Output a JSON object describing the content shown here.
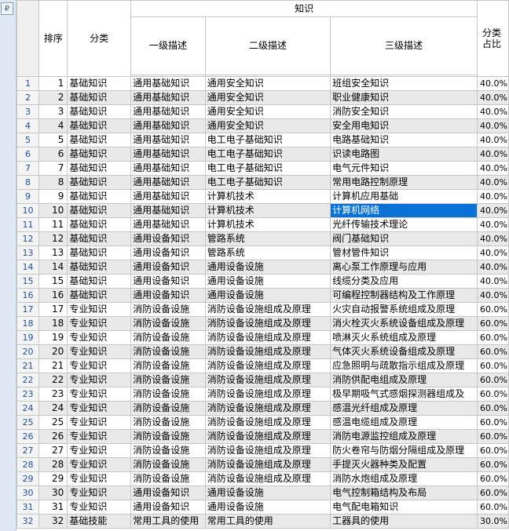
{
  "header": {
    "group": "知识",
    "col_order": "排序",
    "col_category": "分类",
    "col_level1": "一级描述",
    "col_level2": "二级描述",
    "col_level3": "三级描述",
    "col_ratio_line1": "分类",
    "col_ratio_line2": "占比"
  },
  "rows": [
    {
      "n": "1",
      "order": "1",
      "cat": "基础知识",
      "l1": "通用基础知识",
      "l2": "通用安全知识",
      "l3": "班组安全知识",
      "ratio": "40.0%"
    },
    {
      "n": "2",
      "order": "2",
      "cat": "基础知识",
      "l1": "通用基础知识",
      "l2": "通用安全知识",
      "l3": "职业健康知识",
      "ratio": "40.0%"
    },
    {
      "n": "3",
      "order": "3",
      "cat": "基础知识",
      "l1": "通用基础知识",
      "l2": "通用安全知识",
      "l3": "消防安全知识",
      "ratio": "40.0%"
    },
    {
      "n": "4",
      "order": "4",
      "cat": "基础知识",
      "l1": "通用基础知识",
      "l2": "通用安全知识",
      "l3": "安全用电知识",
      "ratio": "40.0%"
    },
    {
      "n": "5",
      "order": "5",
      "cat": "基础知识",
      "l1": "通用基础知识",
      "l2": "电工电子基础知识",
      "l3": "电路基础知识",
      "ratio": "40.0%"
    },
    {
      "n": "6",
      "order": "6",
      "cat": "基础知识",
      "l1": "通用基础知识",
      "l2": "电工电子基础知识",
      "l3": "识读电路图",
      "ratio": "40.0%"
    },
    {
      "n": "7",
      "order": "7",
      "cat": "基础知识",
      "l1": "通用基础知识",
      "l2": "电工电子基础知识",
      "l3": "电气元件知识",
      "ratio": "40.0%"
    },
    {
      "n": "8",
      "order": "8",
      "cat": "基础知识",
      "l1": "通用基础知识",
      "l2": "电工电子基础知识",
      "l3": "常用电路控制原理",
      "ratio": "40.0%"
    },
    {
      "n": "9",
      "order": "9",
      "cat": "基础知识",
      "l1": "通用基础知识",
      "l2": "计算机技术",
      "l3": "计算机应用基础",
      "ratio": "40.0%"
    },
    {
      "n": "10",
      "order": "10",
      "cat": "基础知识",
      "l1": "通用基础知识",
      "l2": "计算机技术",
      "l3": "计算机网络",
      "ratio": "40.0%"
    },
    {
      "n": "11",
      "order": "11",
      "cat": "基础知识",
      "l1": "通用基础知识",
      "l2": "计算机技术",
      "l3": "光纤传输技术理论",
      "ratio": "40.0%"
    },
    {
      "n": "12",
      "order": "12",
      "cat": "基础知识",
      "l1": "通用设备知识",
      "l2": "管路系统",
      "l3": "阀门基础知识",
      "ratio": "40.0%"
    },
    {
      "n": "13",
      "order": "13",
      "cat": "基础知识",
      "l1": "通用设备知识",
      "l2": "管路系统",
      "l3": "管材管件知识",
      "ratio": "40.0%"
    },
    {
      "n": "14",
      "order": "14",
      "cat": "基础知识",
      "l1": "通用设备知识",
      "l2": "通用设备设施",
      "l3": "离心泵工作原理与应用",
      "ratio": "40.0%"
    },
    {
      "n": "15",
      "order": "15",
      "cat": "基础知识",
      "l1": "通用设备知识",
      "l2": "通用设备设施",
      "l3": "线缆分类及应用",
      "ratio": "40.0%"
    },
    {
      "n": "16",
      "order": "16",
      "cat": "基础知识",
      "l1": "通用设备知识",
      "l2": "通用设备设施",
      "l3": "可编程控制器结构及工作原理",
      "ratio": "40.0%"
    },
    {
      "n": "17",
      "order": "17",
      "cat": "专业知识",
      "l1": "消防设备设施",
      "l2": "消防设备设施组成及原理",
      "l3": "火灾自动报警系统组成及原理",
      "ratio": "60.0%"
    },
    {
      "n": "18",
      "order": "18",
      "cat": "专业知识",
      "l1": "消防设备设施",
      "l2": "消防设备设施组成及原理",
      "l3": "消火栓灭火系统设备组成及原理",
      "ratio": "60.0%"
    },
    {
      "n": "19",
      "order": "19",
      "cat": "专业知识",
      "l1": "消防设备设施",
      "l2": "消防设备设施组成及原理",
      "l3": "喷淋灭火系统组成及原理",
      "ratio": "60.0%"
    },
    {
      "n": "20",
      "order": "20",
      "cat": "专业知识",
      "l1": "消防设备设施",
      "l2": "消防设备设施组成及原理",
      "l3": "气体灭火系统设备组成及原理",
      "ratio": "60.0%"
    },
    {
      "n": "21",
      "order": "21",
      "cat": "专业知识",
      "l1": "消防设备设施",
      "l2": "消防设备设施组成及原理",
      "l3": "应急照明与疏散指示组成及原理",
      "ratio": "60.0%"
    },
    {
      "n": "22",
      "order": "22",
      "cat": "专业知识",
      "l1": "消防设备设施",
      "l2": "消防设备设施组成及原理",
      "l3": "消防供配电组成及原理",
      "ratio": "60.0%"
    },
    {
      "n": "23",
      "order": "23",
      "cat": "专业知识",
      "l1": "消防设备设施",
      "l2": "消防设备设施组成及原理",
      "l3": "极早期吸气式感烟探测器组成及",
      "ratio": "60.0%"
    },
    {
      "n": "24",
      "order": "24",
      "cat": "专业知识",
      "l1": "消防设备设施",
      "l2": "消防设备设施组成及原理",
      "l3": "感温光纤组成及原理",
      "ratio": "60.0%"
    },
    {
      "n": "25",
      "order": "25",
      "cat": "专业知识",
      "l1": "消防设备设施",
      "l2": "消防设备设施组成及原理",
      "l3": "感温电缆组成及原理",
      "ratio": "60.0%"
    },
    {
      "n": "26",
      "order": "26",
      "cat": "专业知识",
      "l1": "消防设备设施",
      "l2": "消防设备设施组成及原理",
      "l3": "消防电源监控组成及原理",
      "ratio": "60.0%"
    },
    {
      "n": "27",
      "order": "27",
      "cat": "专业知识",
      "l1": "消防设备设施",
      "l2": "消防设备设施组成及原理",
      "l3": "防火卷帘与防烟分隔组成及原理",
      "ratio": "60.0%"
    },
    {
      "n": "28",
      "order": "28",
      "cat": "专业知识",
      "l1": "消防设备设施",
      "l2": "消防设备设施组成及原理",
      "l3": "手提灭火器种类及配置",
      "ratio": "60.0%"
    },
    {
      "n": "29",
      "order": "29",
      "cat": "专业知识",
      "l1": "消防设备设施",
      "l2": "消防设备设施组成及原理",
      "l3": "消防水炮组成及原理",
      "ratio": "60.0%"
    },
    {
      "n": "30",
      "order": "30",
      "cat": "专业知识",
      "l1": "通用设备知识",
      "l2": "通用设备设施",
      "l3": "电气控制箱结构及布局",
      "ratio": "60.0%"
    },
    {
      "n": "31",
      "order": "31",
      "cat": "专业知识",
      "l1": "通用设备知识",
      "l2": "通用设备设施",
      "l3": "电气配电箱知识",
      "ratio": "60.0%"
    },
    {
      "n": "32",
      "order": "32",
      "cat": "基础技能",
      "l1": "常用工具的使用",
      "l2": "常用工具的使用",
      "l3": "工器具的使用",
      "ratio": "30.0%"
    }
  ],
  "selected_row": "10"
}
